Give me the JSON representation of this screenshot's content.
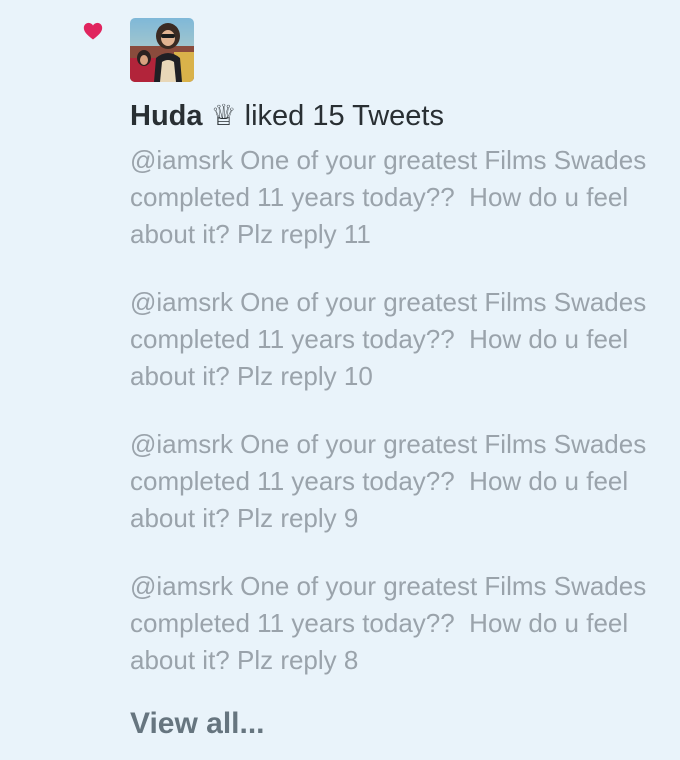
{
  "notification": {
    "icon": "heart-icon",
    "accent_color": "#e0245e",
    "user_name": "Huda",
    "user_emoji": "♕",
    "action_text": "liked 15 Tweets",
    "tweets": [
      {
        "text": "@iamsrk One of your greatest Films Swades completed 11 years today??  How do u feel about it? Plz reply 11"
      },
      {
        "text": "@iamsrk One of your greatest Films Swades completed 11 years today??  How do u feel about it? Plz reply 10"
      },
      {
        "text": "@iamsrk One of your greatest Films Swades completed 11 years today??  How do u feel about it? Plz reply 9"
      },
      {
        "text": "@iamsrk One of your greatest Films Swades completed 11 years today??  How do u feel about it? Plz reply 8"
      }
    ],
    "view_all_label": "View all..."
  }
}
